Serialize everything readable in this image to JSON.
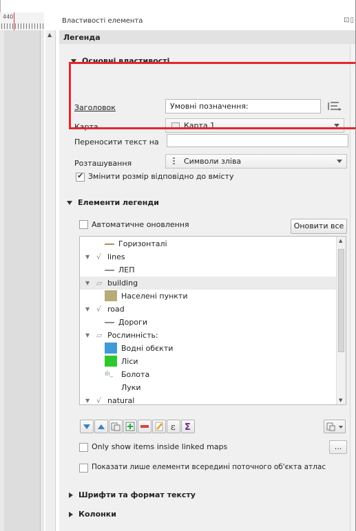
{
  "ruler": {
    "number": "440"
  },
  "panel": {
    "title": "Властивості елемента",
    "header_icons": "⊡▯"
  },
  "legend_bar": {
    "title": "Легенда"
  },
  "main_props": {
    "title": "Основні властивості",
    "title_label": "Заголовок",
    "title_value": "Умовні позначення:",
    "map_label": "Карта",
    "map_value": "Карта 1",
    "wrap_label": "Переносити текст на",
    "wrap_value": "",
    "arrangement_label": "Розташування",
    "arrangement_value": "Символи зліва",
    "resize_label": "Змінити розмір відповідно до вмісту",
    "resize_checked": true
  },
  "legend_items": {
    "title": "Елементи легенди",
    "auto_update_label": "Автоматичне оновлення",
    "update_all_label": "Оновити все",
    "tree": [
      {
        "label": "Горизонталі",
        "level": 1,
        "sym": "line",
        "color": "#b08d57"
      },
      {
        "label": "lines",
        "level": 0,
        "sym": "group-line",
        "twisty": true
      },
      {
        "label": "ЛЕП",
        "level": 1,
        "sym": "line",
        "color": "#8c8c8c"
      },
      {
        "label": "building",
        "level": 0,
        "sym": "group-poly",
        "twisty": true,
        "selected": true
      },
      {
        "label": "Населені пункти",
        "level": 1,
        "sym": "fill",
        "color": "#b7ac78"
      },
      {
        "label": "road",
        "level": 0,
        "sym": "group-line",
        "twisty": true
      },
      {
        "label": "Дороги",
        "level": 1,
        "sym": "line",
        "color": "#8c8c8c"
      },
      {
        "label": "Рослинність:",
        "level": 0,
        "sym": "group-poly",
        "twisty": true
      },
      {
        "label": "Водні обєкти",
        "level": 1,
        "sym": "fill",
        "color": "#3f9ad6"
      },
      {
        "label": "Ліси",
        "level": 1,
        "sym": "fill",
        "color": "#2ec82e"
      },
      {
        "label": "Болота",
        "level": 1,
        "sym": "marsh",
        "color": "#6b8f6b"
      },
      {
        "label": "Луки",
        "level": 1,
        "sym": "none",
        "color": ""
      },
      {
        "label": "natural",
        "level": 0,
        "sym": "group-line",
        "twisty": true
      }
    ],
    "only_linked_label": "Only show items inside linked maps",
    "only_linked_btn": "...",
    "atlas_label": "Показати лише елементи всередині поточного об'єкта атлас"
  },
  "collapsed_sections": {
    "fonts": "Шрифти та формат тексту",
    "columns": "Колонки"
  },
  "colors": {
    "highlight": "#e3262b"
  }
}
